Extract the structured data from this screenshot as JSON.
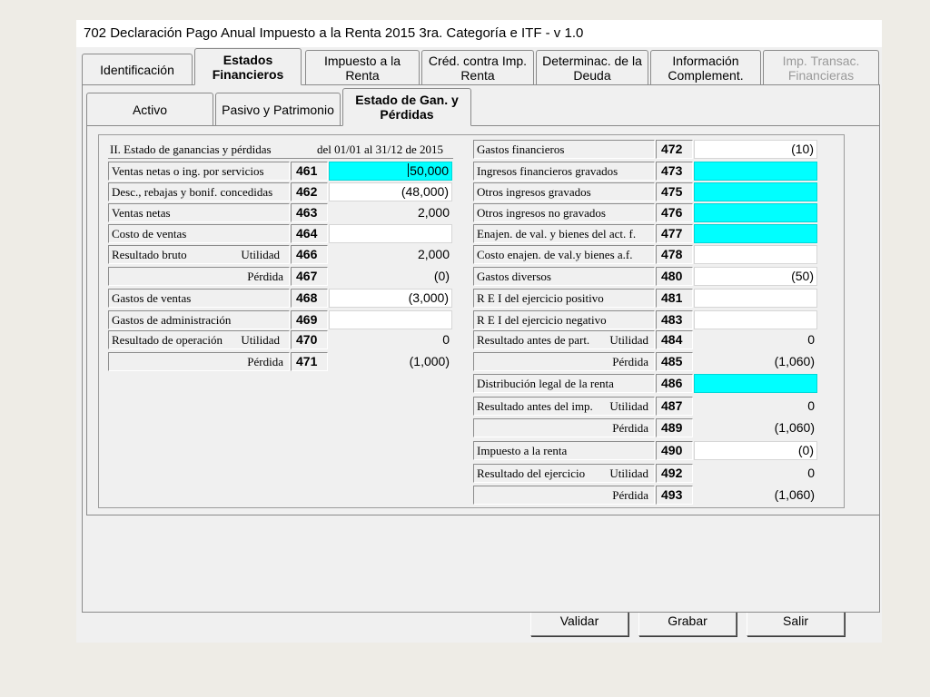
{
  "window": {
    "title": "702 Declaración Pago Anual Impuesto a la Renta 2015 3ra. Categoría e ITF - v 1.0"
  },
  "main_tabs": [
    {
      "label": "Identificación"
    },
    {
      "label": "Estados\nFinancieros"
    },
    {
      "label": "Impuesto a  la\nRenta"
    },
    {
      "label": "Créd. contra Imp.\nRenta"
    },
    {
      "label": "Determinac. de la\nDeuda"
    },
    {
      "label": "Información\nComplement."
    },
    {
      "label": "Imp. Transac.\nFinancieras"
    }
  ],
  "sub_tabs": [
    {
      "label": "Activo"
    },
    {
      "label": "Pasivo y Patrimonio"
    },
    {
      "label": "Estado de Gan. y\nPérdidas"
    }
  ],
  "section": {
    "title": "II. Estado de ganancias y pérdidas",
    "period": "del 01/01 al 31/12 de 2015"
  },
  "left_rows": [
    {
      "label": "Ventas netas o ing. por servicios",
      "code": "461",
      "value": "50,000"
    },
    {
      "label": "Desc., rebajas y bonif. concedidas",
      "code": "462",
      "value": "(48,000)"
    },
    {
      "label": "Ventas netas",
      "code": "463",
      "value": "2,000"
    },
    {
      "label": "Costo de ventas",
      "code": "464",
      "value": ""
    },
    {
      "label": "Resultado bruto",
      "sublabel": "Utilidad",
      "code": "466",
      "value": "2,000"
    },
    {
      "label": "",
      "sublabel": "Pérdida",
      "code": "467",
      "value": "(0)"
    },
    {
      "label": "Gastos de ventas",
      "code": "468",
      "value": "(3,000)"
    },
    {
      "label": "Gastos de administración",
      "code": "469",
      "value": ""
    },
    {
      "label": "Resultado de operación",
      "sublabel": "Utilidad",
      "code": "470",
      "value": "0"
    },
    {
      "label": "",
      "sublabel": "Pérdida",
      "code": "471",
      "value": "(1,000)"
    }
  ],
  "right_rows": [
    {
      "label": "Gastos financieros",
      "code": "472",
      "value": "(10)"
    },
    {
      "label": "Ingresos financieros gravados",
      "code": "473",
      "value": ""
    },
    {
      "label": "Otros ingresos gravados",
      "code": "475",
      "value": ""
    },
    {
      "label": "Otros ingresos no gravados",
      "code": "476",
      "value": ""
    },
    {
      "label": "Enajen. de val. y bienes del act. f.",
      "code": "477",
      "value": ""
    },
    {
      "label": "Costo enajen. de val.y bienes a.f.",
      "code": "478",
      "value": ""
    },
    {
      "label": "Gastos diversos",
      "code": "480",
      "value": "(50)"
    },
    {
      "label": "R E I del ejercicio positivo",
      "code": "481",
      "value": ""
    },
    {
      "label": "R E I del ejercicio negativo",
      "code": "483",
      "value": ""
    },
    {
      "label": "Resultado antes de part.",
      "sublabel": "Utilidad",
      "code": "484",
      "value": "0"
    },
    {
      "label": "",
      "sublabel": "Pérdida",
      "code": "485",
      "value": "(1,060)"
    },
    {
      "label": "Distribución legal de la renta",
      "code": "486",
      "value": ""
    },
    {
      "label": "Resultado antes del imp.",
      "sublabel": "Utilidad",
      "code": "487",
      "value": "0"
    },
    {
      "label": "",
      "sublabel": "Pérdida",
      "code": "489",
      "value": "(1,060)"
    },
    {
      "label": "Impuesto a la renta",
      "code": "490",
      "value": "(0)"
    },
    {
      "label": "Resultado del ejercicio",
      "sublabel": "Utilidad",
      "code": "492",
      "value": "0"
    },
    {
      "label": "",
      "sublabel": "Pérdida",
      "code": "493",
      "value": "(1,060)"
    }
  ],
  "buttons": {
    "validar": "Validar",
    "grabar": "Grabar",
    "salir": "Salir"
  },
  "colors": {
    "highlight_field": "#00ffff",
    "input_field": "#ffffff"
  }
}
